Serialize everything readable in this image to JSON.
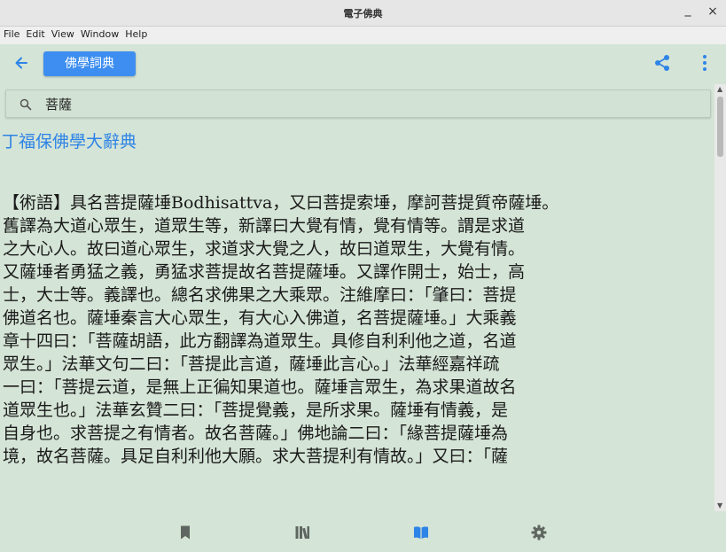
{
  "window": {
    "title": "電子佛典",
    "minimize_glyph": "_",
    "close_glyph": "×"
  },
  "menubar": {
    "items": [
      "File",
      "Edit",
      "View",
      "Window",
      "Help"
    ]
  },
  "toolbar": {
    "back_icon": "arrow-left-icon",
    "dictionary_button": "佛學詞典",
    "share_icon": "share-icon",
    "more_icon": "more-vertical-icon"
  },
  "search": {
    "icon": "search-icon",
    "value": "菩薩"
  },
  "entry": {
    "dictionary_name": "丁福保佛學大辭典",
    "lines": [
      "【術語】具名菩提薩埵Bodhisattva，又曰菩提索埵，摩訶菩提質帝薩埵。",
      "舊譯為大道心眾生，道眾生等，新譯曰大覺有情，覺有情等。謂是求道",
      "之大心人。故曰道心眾生，求道求大覺之人，故曰道眾生，大覺有情。",
      "又薩埵者勇猛之義，勇猛求菩提故名菩提薩埵。又譯作開士，始士，高",
      "士，大士等。義譯也。總名求佛果之大乘眾。注維摩曰：「肇曰：菩提",
      "佛道名也。薩埵秦言大心眾生，有大心入佛道，名菩提薩埵。」大乘義",
      "章十四曰：「菩薩胡語，此方翻譯為道眾生。具修自利利他之道，名道",
      "眾生。」法華文句二曰：「菩提此言道，薩埵此言心。」法華經嘉祥疏",
      "一曰：「菩提云道，是無上正徧知果道也。薩埵言眾生，為求果道故名",
      "道眾生也。」法華玄贊二曰：「菩提覺義，是所求果。薩埵有情義，是",
      "自身也。求菩提之有情者。故名菩薩。」佛地論二曰：「緣菩提薩埵為",
      "境，故名菩薩。具足自利利他大願。求大菩提利有情故。」又曰：「薩"
    ]
  },
  "bottom_nav": {
    "items": [
      {
        "icon": "bookmark-icon",
        "active": false
      },
      {
        "icon": "library-icon",
        "active": false
      },
      {
        "icon": "book-open-icon",
        "active": true
      },
      {
        "icon": "settings-gear-icon",
        "active": false
      }
    ]
  },
  "colors": {
    "accent": "#3d8ef0",
    "background": "#d4e4d6",
    "dictionary_name": "#2e84e6",
    "inactive_icon": "#5f6661"
  }
}
